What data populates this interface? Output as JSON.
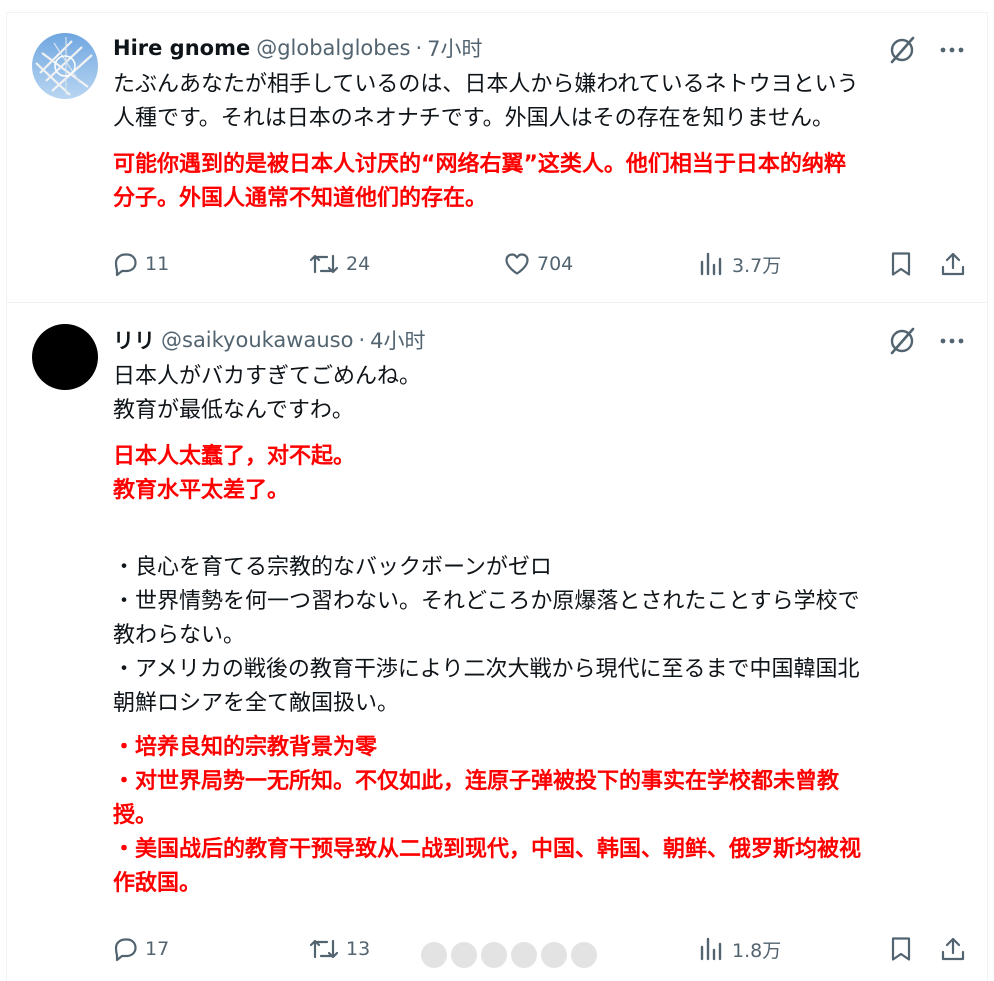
{
  "tweets": [
    {
      "display_name": "Hire gnome",
      "handle": "@globalglobes",
      "separator": "·",
      "time": "7小时",
      "text_original": "たぶんあなたが相手しているのは、日本人から嫌われているネトウヨという\n人種です。それは日本のネオナチです。外国人はその存在を知りません。",
      "text_translation": "可能你遇到的是被日本人讨厌的“网络右翼”这类人。他们相当于日本的纳粹\n分子。外国人通常不知道他们的存在。",
      "stats": {
        "replies": "11",
        "retweets": "24",
        "likes": "704",
        "views": "3.7万"
      }
    },
    {
      "display_name": "リリ",
      "handle": "@saikyoukawauso",
      "separator": "·",
      "time": "4小时",
      "text_original": "日本人がバカすぎてごめんね。\n教育が最低なんですわ。",
      "text_translation": "日本人太蠢了，对不起。\n教育水平太差了。",
      "text_original_2": "・良心を育てる宗教的なバックボーンがゼロ\n・世界情勢を何一つ習わない。それどころか原爆落とされたことすら学校で\n教わらない。\n・アメリカの戦後の教育干渉により二次大戦から現代に至るまで中国韓国北\n朝鮮ロシアを全て敵国扱い。",
      "text_translation_2": "・培养良知的宗教背景为零\n・对世界局势一无所知。不仅如此，连原子弹被投下的事实在学校都未曾教\n授。\n・美国战后的教育干预导致从二战到现代，中国、韩国、朝鲜、俄罗斯均被视\n作敌国。",
      "stats": {
        "replies": "17",
        "retweets": "13",
        "likes": "",
        "views": "1.8万"
      }
    }
  ],
  "icons": [
    "grok-icon",
    "more-icon",
    "reply-icon",
    "retweet-icon",
    "like-icon",
    "views-icon",
    "bookmark-icon",
    "share-icon"
  ],
  "colors": {
    "text": "#0f1419",
    "secondary": "#536471",
    "translation": "#ff0000",
    "divider": "#eff3f4"
  }
}
